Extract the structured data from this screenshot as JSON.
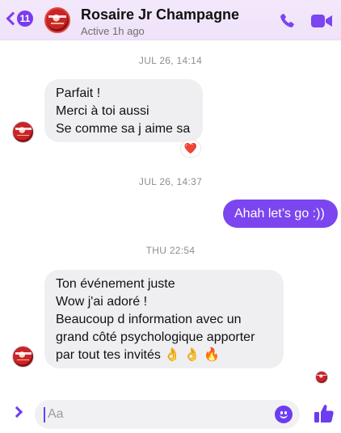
{
  "header": {
    "back_badge": "11",
    "name": "Rosaire Jr Champagne",
    "status": "Active 1h ago",
    "icons": [
      "back-chevron-icon",
      "phone-icon",
      "video-camera-icon"
    ],
    "accent": "#7b45ef"
  },
  "messages": {
    "stamp1": "JUL 26, 14:14",
    "msg1": [
      "Parfait !",
      "Merci à toi aussi",
      "Se comme sa j aime sa"
    ],
    "reaction1": "❤️",
    "stamp2": "JUL 26, 14:37",
    "msg2": "Ahah let’s go :))",
    "stamp3": "THU 22:54",
    "msg3": [
      "Ton événement juste",
      "Wow j'ai adoré !",
      "Beaucoup d information avec un",
      "grand côté psychologique apporter",
      "par tout tes invités 👌 👌 🔥"
    ]
  },
  "composer": {
    "placeholder": "Aa",
    "icons": [
      "expand-chevron-icon",
      "emoji-icon",
      "thumbs-up-icon"
    ]
  }
}
